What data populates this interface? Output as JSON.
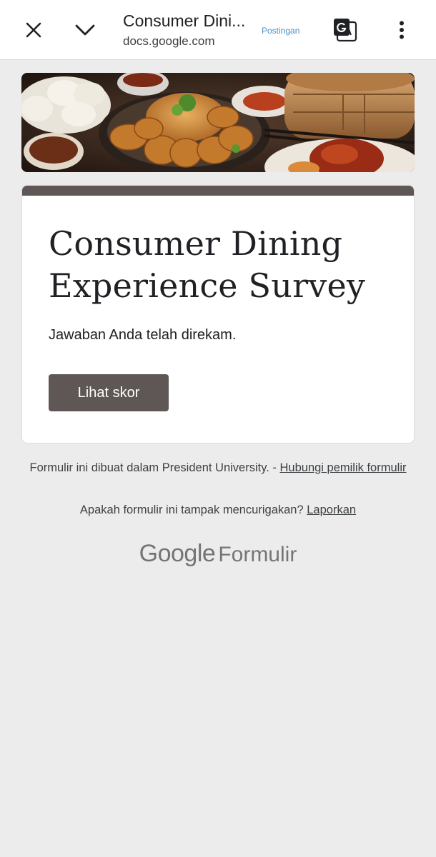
{
  "browser": {
    "title": "Consumer Dini...",
    "url": "docs.google.com",
    "postingan_label": "Postingan",
    "icons": [
      "close-icon",
      "chevron-down-icon",
      "translate-icon",
      "more-vert-icon"
    ]
  },
  "banner": {
    "description": "food photo banner"
  },
  "form": {
    "title": "Consumer Dining Experience Survey",
    "confirmation": "Jawaban Anda telah direkam.",
    "score_button": "Lihat skor",
    "accent_color": "#5f5756"
  },
  "footer": {
    "created_text": "Formulir ini dibuat dalam President University. - ",
    "contact_link": "Hubungi pemilik formulir",
    "suspicious_text": "Apakah formulir ini tampak mencurigakan? ",
    "report_link": "Laporkan",
    "brand_google": "Google",
    "brand_forms": "Formulir"
  }
}
